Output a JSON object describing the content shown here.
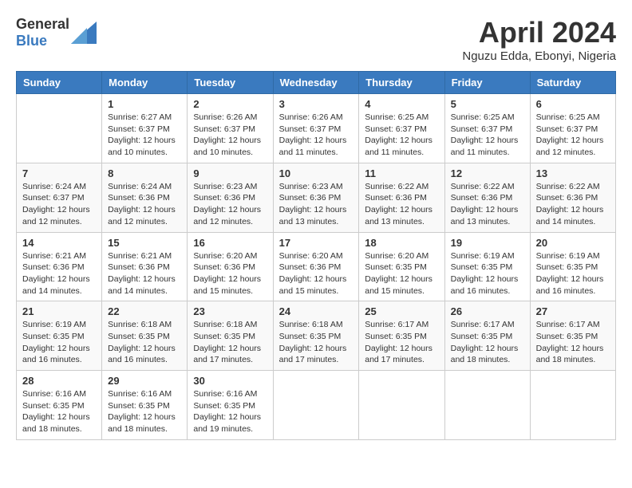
{
  "header": {
    "logo_general": "General",
    "logo_blue": "Blue",
    "month_title": "April 2024",
    "location": "Nguzu Edda, Ebonyi, Nigeria"
  },
  "weekdays": [
    "Sunday",
    "Monday",
    "Tuesday",
    "Wednesday",
    "Thursday",
    "Friday",
    "Saturday"
  ],
  "weeks": [
    [
      {
        "day": "",
        "sunrise": "",
        "sunset": "",
        "daylight": ""
      },
      {
        "day": "1",
        "sunrise": "Sunrise: 6:27 AM",
        "sunset": "Sunset: 6:37 PM",
        "daylight": "Daylight: 12 hours and 10 minutes."
      },
      {
        "day": "2",
        "sunrise": "Sunrise: 6:26 AM",
        "sunset": "Sunset: 6:37 PM",
        "daylight": "Daylight: 12 hours and 10 minutes."
      },
      {
        "day": "3",
        "sunrise": "Sunrise: 6:26 AM",
        "sunset": "Sunset: 6:37 PM",
        "daylight": "Daylight: 12 hours and 11 minutes."
      },
      {
        "day": "4",
        "sunrise": "Sunrise: 6:25 AM",
        "sunset": "Sunset: 6:37 PM",
        "daylight": "Daylight: 12 hours and 11 minutes."
      },
      {
        "day": "5",
        "sunrise": "Sunrise: 6:25 AM",
        "sunset": "Sunset: 6:37 PM",
        "daylight": "Daylight: 12 hours and 11 minutes."
      },
      {
        "day": "6",
        "sunrise": "Sunrise: 6:25 AM",
        "sunset": "Sunset: 6:37 PM",
        "daylight": "Daylight: 12 hours and 12 minutes."
      }
    ],
    [
      {
        "day": "7",
        "sunrise": "Sunrise: 6:24 AM",
        "sunset": "Sunset: 6:37 PM",
        "daylight": "Daylight: 12 hours and 12 minutes."
      },
      {
        "day": "8",
        "sunrise": "Sunrise: 6:24 AM",
        "sunset": "Sunset: 6:36 PM",
        "daylight": "Daylight: 12 hours and 12 minutes."
      },
      {
        "day": "9",
        "sunrise": "Sunrise: 6:23 AM",
        "sunset": "Sunset: 6:36 PM",
        "daylight": "Daylight: 12 hours and 12 minutes."
      },
      {
        "day": "10",
        "sunrise": "Sunrise: 6:23 AM",
        "sunset": "Sunset: 6:36 PM",
        "daylight": "Daylight: 12 hours and 13 minutes."
      },
      {
        "day": "11",
        "sunrise": "Sunrise: 6:22 AM",
        "sunset": "Sunset: 6:36 PM",
        "daylight": "Daylight: 12 hours and 13 minutes."
      },
      {
        "day": "12",
        "sunrise": "Sunrise: 6:22 AM",
        "sunset": "Sunset: 6:36 PM",
        "daylight": "Daylight: 12 hours and 13 minutes."
      },
      {
        "day": "13",
        "sunrise": "Sunrise: 6:22 AM",
        "sunset": "Sunset: 6:36 PM",
        "daylight": "Daylight: 12 hours and 14 minutes."
      }
    ],
    [
      {
        "day": "14",
        "sunrise": "Sunrise: 6:21 AM",
        "sunset": "Sunset: 6:36 PM",
        "daylight": "Daylight: 12 hours and 14 minutes."
      },
      {
        "day": "15",
        "sunrise": "Sunrise: 6:21 AM",
        "sunset": "Sunset: 6:36 PM",
        "daylight": "Daylight: 12 hours and 14 minutes."
      },
      {
        "day": "16",
        "sunrise": "Sunrise: 6:20 AM",
        "sunset": "Sunset: 6:36 PM",
        "daylight": "Daylight: 12 hours and 15 minutes."
      },
      {
        "day": "17",
        "sunrise": "Sunrise: 6:20 AM",
        "sunset": "Sunset: 6:36 PM",
        "daylight": "Daylight: 12 hours and 15 minutes."
      },
      {
        "day": "18",
        "sunrise": "Sunrise: 6:20 AM",
        "sunset": "Sunset: 6:35 PM",
        "daylight": "Daylight: 12 hours and 15 minutes."
      },
      {
        "day": "19",
        "sunrise": "Sunrise: 6:19 AM",
        "sunset": "Sunset: 6:35 PM",
        "daylight": "Daylight: 12 hours and 16 minutes."
      },
      {
        "day": "20",
        "sunrise": "Sunrise: 6:19 AM",
        "sunset": "Sunset: 6:35 PM",
        "daylight": "Daylight: 12 hours and 16 minutes."
      }
    ],
    [
      {
        "day": "21",
        "sunrise": "Sunrise: 6:19 AM",
        "sunset": "Sunset: 6:35 PM",
        "daylight": "Daylight: 12 hours and 16 minutes."
      },
      {
        "day": "22",
        "sunrise": "Sunrise: 6:18 AM",
        "sunset": "Sunset: 6:35 PM",
        "daylight": "Daylight: 12 hours and 16 minutes."
      },
      {
        "day": "23",
        "sunrise": "Sunrise: 6:18 AM",
        "sunset": "Sunset: 6:35 PM",
        "daylight": "Daylight: 12 hours and 17 minutes."
      },
      {
        "day": "24",
        "sunrise": "Sunrise: 6:18 AM",
        "sunset": "Sunset: 6:35 PM",
        "daylight": "Daylight: 12 hours and 17 minutes."
      },
      {
        "day": "25",
        "sunrise": "Sunrise: 6:17 AM",
        "sunset": "Sunset: 6:35 PM",
        "daylight": "Daylight: 12 hours and 17 minutes."
      },
      {
        "day": "26",
        "sunrise": "Sunrise: 6:17 AM",
        "sunset": "Sunset: 6:35 PM",
        "daylight": "Daylight: 12 hours and 18 minutes."
      },
      {
        "day": "27",
        "sunrise": "Sunrise: 6:17 AM",
        "sunset": "Sunset: 6:35 PM",
        "daylight": "Daylight: 12 hours and 18 minutes."
      }
    ],
    [
      {
        "day": "28",
        "sunrise": "Sunrise: 6:16 AM",
        "sunset": "Sunset: 6:35 PM",
        "daylight": "Daylight: 12 hours and 18 minutes."
      },
      {
        "day": "29",
        "sunrise": "Sunrise: 6:16 AM",
        "sunset": "Sunset: 6:35 PM",
        "daylight": "Daylight: 12 hours and 18 minutes."
      },
      {
        "day": "30",
        "sunrise": "Sunrise: 6:16 AM",
        "sunset": "Sunset: 6:35 PM",
        "daylight": "Daylight: 12 hours and 19 minutes."
      },
      {
        "day": "",
        "sunrise": "",
        "sunset": "",
        "daylight": ""
      },
      {
        "day": "",
        "sunrise": "",
        "sunset": "",
        "daylight": ""
      },
      {
        "day": "",
        "sunrise": "",
        "sunset": "",
        "daylight": ""
      },
      {
        "day": "",
        "sunrise": "",
        "sunset": "",
        "daylight": ""
      }
    ]
  ]
}
